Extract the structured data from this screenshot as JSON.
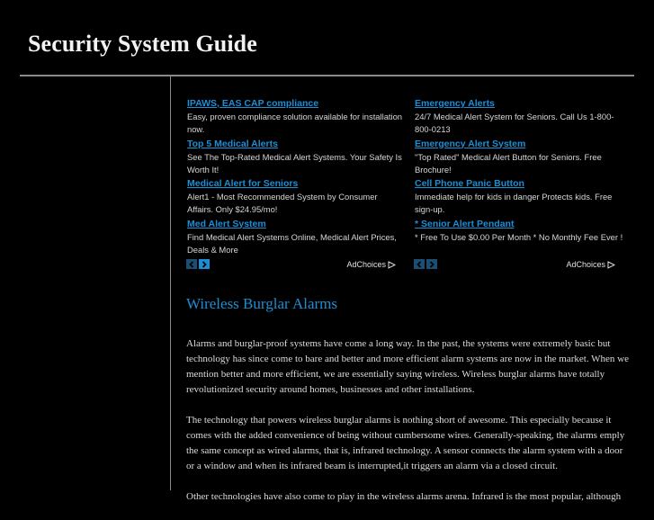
{
  "site": {
    "title": "Security System Guide"
  },
  "colors": {
    "accent": "#1b8fd6",
    "background": "#000000",
    "rule": "#8a8a8a",
    "text": "#dcdcdc"
  },
  "ads": {
    "left": [
      {
        "title": "IPAWS, EAS CAP compliance",
        "description": "Easy, proven compliance solution available for installation now."
      },
      {
        "title": "Top 5 Medical Alerts",
        "description": "See The Top-Rated Medical Alert Systems. Your Safety Is Worth It!"
      },
      {
        "title": "Medical Alert for Seniors",
        "description": "Alert1 - Most Recommended System by Consumer Affairs. Only $24.95/mo!"
      },
      {
        "title": "Med Alert System",
        "description": "Find Medical Alert Systems Online, Medical Alert Prices, Deals & More"
      }
    ],
    "right": [
      {
        "title": "Emergency Alerts",
        "description": "24/7 Medical Alert System for Seniors. Call Us 1-800-800-0213"
      },
      {
        "title": "Emergency Alert System",
        "description": "\"Top Rated\" Medical Alert Button for Seniors. Free Brochure!"
      },
      {
        "title": "Cell Phone Panic Button",
        "description": "Immediate help for kids in danger Protects kids. Free sign-up."
      },
      {
        "title": "* Senior Alert Pendant",
        "description": "* Free To Use $0.00 Per Month * No Monthly Fee Ever !"
      }
    ],
    "adchoices_label": "AdChoices",
    "icons": {
      "prev": "chevron-left-icon",
      "next": "chevron-right-icon",
      "adchoices": "adchoices-triangle-icon"
    }
  },
  "article": {
    "title": "Wireless Burglar Alarms",
    "paragraphs": [
      "Alarms and burglar-proof systems have come a long way. In the past, the systems were extremely basic but technology has since come to bare and better and more efficient alarm systems are now in the market. When we mention better and more efficient, we are essentially saying wireless. Wireless burglar alarms have totally revolutionized security around homes, businesses and other installations.",
      "The technology that powers wireless burglar alarms is nothing short of awesome. This especially because it comes with the added convenience of being without cumbersome wires. Generally-speaking, the alarms emply the same concept as wired alarms, that is, infrared technology. A sensor connects the alarm system with a door or a window  and when its infrared beam is interrupted,it triggers an alarm via a closed circuit.",
      "Other technologies have also come to play in the wireless alarms arena. Infrared is the most popular, although"
    ]
  }
}
